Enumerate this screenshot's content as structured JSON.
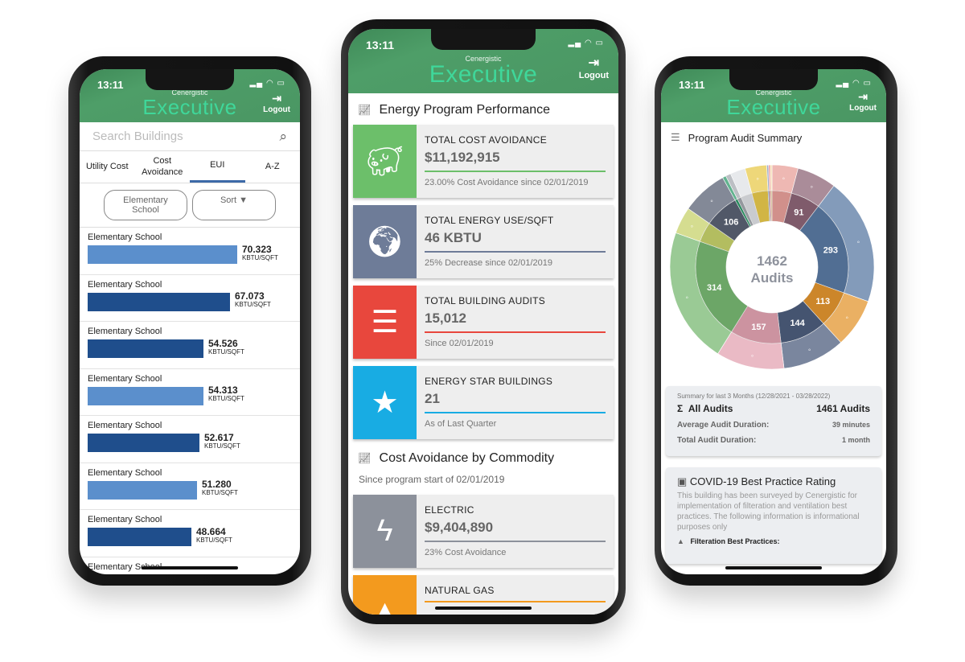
{
  "status": {
    "time": "13:11"
  },
  "header": {
    "brand_small": "Cenergistic",
    "brand": "Executive",
    "logout": "Logout",
    "logout_icon": "sign-out-icon"
  },
  "left": {
    "search_placeholder": "Search Buildings",
    "tabs": [
      {
        "label": "Utility Cost"
      },
      {
        "label": "Cost Avoidance"
      },
      {
        "label": "EUI",
        "active": true
      },
      {
        "label": "A-Z"
      }
    ],
    "filter": "Elementary School",
    "sort": "Sort ▼",
    "unit": "KBTU/SQFT",
    "rows": [
      {
        "name": "Elementary School",
        "value": "70.323",
        "color": "#5b8fcc"
      },
      {
        "name": "Elementary School",
        "value": "67.073",
        "color": "#1f4e8c"
      },
      {
        "name": "Elementary School",
        "value": "54.526",
        "color": "#1f4e8c"
      },
      {
        "name": "Elementary School",
        "value": "54.313",
        "color": "#5b8fcc"
      },
      {
        "name": "Elementary School",
        "value": "52.617",
        "color": "#1f4e8c"
      },
      {
        "name": "Elementary School",
        "value": "51.280",
        "color": "#5b8fcc"
      },
      {
        "name": "Elementary School",
        "value": "48.664",
        "color": "#1f4e8c"
      },
      {
        "name": "Elementary School",
        "value": "",
        "color": "#5b8fcc"
      }
    ]
  },
  "middle": {
    "section1": "Energy Program Performance",
    "cards": [
      {
        "title": "TOTAL COST AVOIDANCE",
        "value": "$11,192,915",
        "sub": "23.00% Cost Avoidance since 02/01/2019",
        "color": "#6cbf6a",
        "icon": "piggy-bank-icon"
      },
      {
        "title": "TOTAL ENERGY USE/SQFT",
        "value": "46 KBTU",
        "sub": "25% Decrease since 02/01/2019",
        "color": "#6e7c98",
        "icon": "globe-icon"
      },
      {
        "title": "TOTAL BUILDING AUDITS",
        "value": "15,012",
        "sub": "Since 02/01/2019",
        "color": "#e8473d",
        "icon": "list-icon"
      },
      {
        "title": "ENERGY STAR BUILDINGS",
        "value": "21",
        "sub": "As of Last Quarter",
        "color": "#18ace3",
        "icon": "star-icon"
      }
    ],
    "section2": "Cost Avoidance by Commodity",
    "section2_sub": "Since program start of 02/01/2019",
    "commodities": [
      {
        "title": "ELECTRIC",
        "value": "$9,404,890",
        "sub": "23% Cost Avoidance",
        "color": "#8c919b",
        "icon": "lightning-icon"
      },
      {
        "title": "NATURAL GAS",
        "value": "",
        "sub": "",
        "color": "#f39a1e",
        "icon": "flame-icon"
      }
    ]
  },
  "right": {
    "title": "Program Audit Summary",
    "summary_caption": "Summary for last 3 Months (12/28/2021 - 03/28/2022)",
    "all_audits_label": "All Audits",
    "all_audits_value": "1461 Audits",
    "avg_label": "Average Audit Duration:",
    "avg_value": "39 minutes",
    "total_label": "Total Audit Duration:",
    "total_value": "1 month",
    "covid_title": "COVID-19 Best Practice Rating",
    "covid_text": "This building has been surveyed by Cenergistic for implementation of filteration and ventilation best practices. The following information is informational purposes only",
    "filtration_label": "Filteration Best Practices:"
  },
  "chart_data": {
    "type": "pie",
    "center_value": "1462",
    "center_label": "Audits",
    "slices": [
      {
        "value": 60,
        "label": "",
        "color": "#e8a09a",
        "icon": "building-icon"
      },
      {
        "value": 91,
        "label": "91",
        "color": "#8d6577",
        "icon": "no-bell-icon"
      },
      {
        "value": 293,
        "label": "293",
        "color": "#5a7aa3",
        "icon": "cloud-upload-icon"
      },
      {
        "value": 113,
        "label": "113",
        "color": "#e3952f",
        "icon": "cookie-icon"
      },
      {
        "value": 144,
        "label": "144",
        "color": "#4d5d7d",
        "icon": "cleaning-icon"
      },
      {
        "value": 157,
        "label": "157",
        "color": "#e3a3b2",
        "icon": "restaurant-icon"
      },
      {
        "value": 314,
        "label": "314",
        "color": "#78b872",
        "icon": "lock-icon"
      },
      {
        "value": 62,
        "label": "",
        "color": "#c7d26b",
        "icon": "calendar-icon"
      },
      {
        "value": 106,
        "label": "106",
        "color": "#5a6274",
        "icon": "truck-icon"
      },
      {
        "value": 8,
        "label": "",
        "color": "#2d9a6a",
        "icon": ""
      },
      {
        "value": 12,
        "label": "",
        "color": "#a5a9b0",
        "icon": ""
      },
      {
        "value": 35,
        "label": "",
        "color": "#dfe2e6",
        "icon": ""
      },
      {
        "value": 50,
        "label": "",
        "color": "#e8c94c",
        "icon": "wrench-icon"
      },
      {
        "value": 4,
        "label": "",
        "color": "#7c8fb8",
        "icon": ""
      },
      {
        "value": 4,
        "label": "",
        "color": "#e87a7a",
        "icon": ""
      },
      {
        "value": 4,
        "label": "",
        "color": "#f1d49a",
        "icon": ""
      }
    ]
  }
}
